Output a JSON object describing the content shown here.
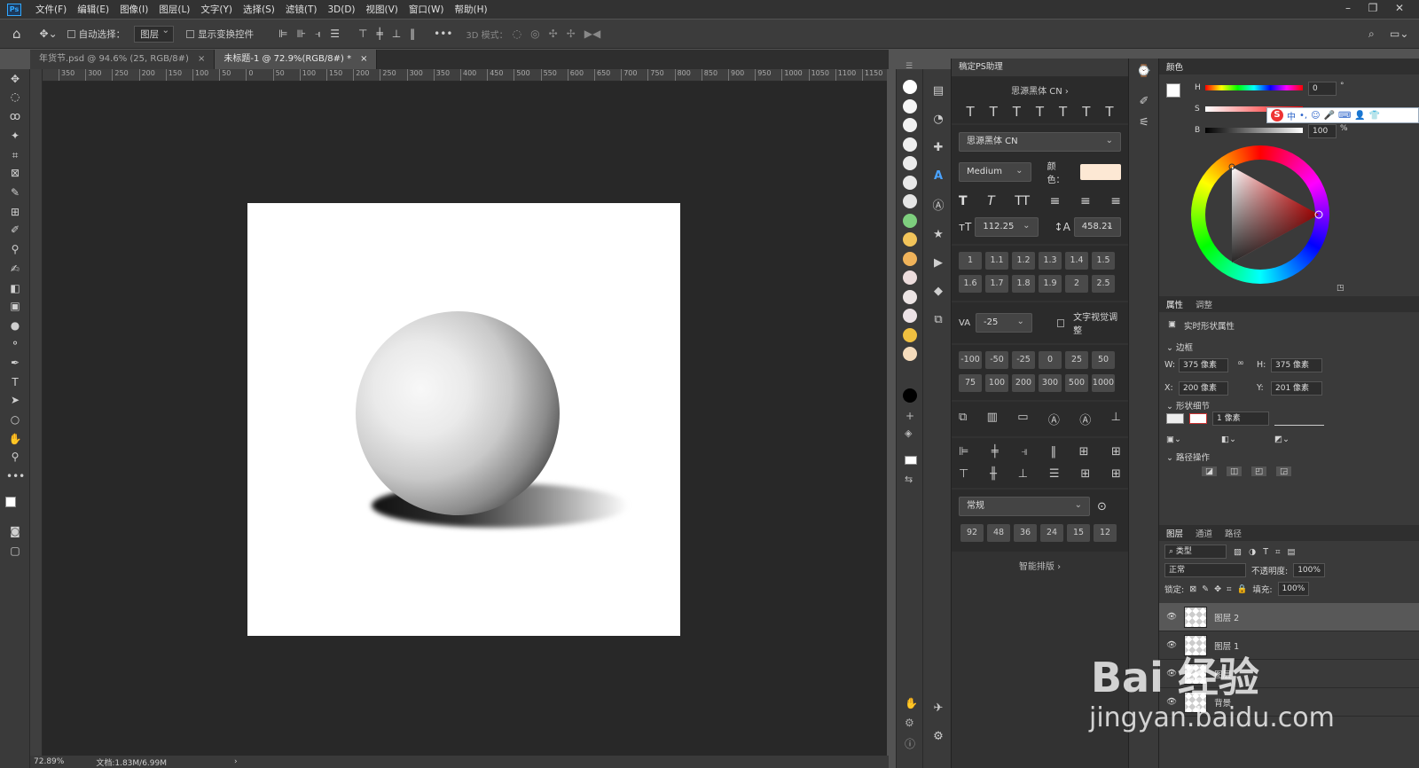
{
  "app": {
    "logo": "Ps"
  },
  "menu": [
    "文件(F)",
    "编辑(E)",
    "图像(I)",
    "图层(L)",
    "文字(Y)",
    "选择(S)",
    "滤镜(T)",
    "3D(D)",
    "视图(V)",
    "窗口(W)",
    "帮助(H)"
  ],
  "options": {
    "auto_select": "自动选择：",
    "layer_select": "图层",
    "show_transform": "显示变换控件",
    "mode_3d": "3D 模式："
  },
  "tabs": [
    {
      "label": "年货节.psd @ 94.6% (25, RGB/8#)",
      "close": "×"
    },
    {
      "label": "未标题-1 @ 72.9%(RGB/8#) *",
      "close": "×"
    }
  ],
  "ruler_ticks": [
    "350",
    "300",
    "250",
    "200",
    "150",
    "100",
    "50",
    "0",
    "50",
    "100",
    "150",
    "200",
    "250",
    "300",
    "350",
    "400",
    "450",
    "500",
    "550",
    "600",
    "650",
    "700",
    "750",
    "800",
    "850",
    "900",
    "950",
    "1000",
    "1050",
    "1100",
    "1150"
  ],
  "status": {
    "zoom": "72.89%",
    "doc": "文档:1.83M/6.99M",
    "arrow": "›"
  },
  "plugin": {
    "title": "稿定PS助理",
    "font_nav": "思源黑体 CN  ›",
    "t_row": [
      "T",
      "T",
      "T",
      "T",
      "T",
      "T",
      "T"
    ],
    "font_family": "思源黑体 CN",
    "font_weight": "Medium",
    "color_label": "颜色：",
    "color_value": "#fde8d4",
    "size": "112.25",
    "leading": "458.21",
    "scale_buttons": [
      "1",
      "1.1",
      "1.2",
      "1.3",
      "1.4",
      "1.5",
      "1.6",
      "1.7",
      "1.8",
      "1.9",
      "2",
      "2.5"
    ],
    "tracking": "-25",
    "visual_adjust": "文字视觉调整",
    "tracking_buttons": [
      "-100",
      "-50",
      "-25",
      "0",
      "25",
      "50",
      "75",
      "100",
      "200",
      "300",
      "500",
      "1000"
    ],
    "blend": "常规",
    "size_buttons": [
      "92",
      "48",
      "36",
      "24",
      "15",
      "12"
    ],
    "smart_layout": "智能排版  ›"
  },
  "swatches": [
    "#ffffff",
    "#f5f5f5",
    "#f1f1f1",
    "#eeeeee",
    "#ebebeb",
    "#e9e9e9",
    "#e5e5e5",
    "#7ecf7e",
    "#f2c45a",
    "#f0b35a",
    "#ecdcdc",
    "#ece4e4",
    "#ece2e6",
    "#f0c040",
    "#f5dcbc"
  ],
  "color_panel": {
    "title": "颜色",
    "h_label": "H",
    "h_value": "0",
    "h_unit": "°",
    "s_label": "S",
    "b_label": "B",
    "b_value": "100",
    "b_unit": "%"
  },
  "properties": {
    "tabs": [
      "属性",
      "调整"
    ],
    "heading": "实时形状属性",
    "border": "边框",
    "w_label": "W:",
    "w_value": "375 像素",
    "h_label": "H:",
    "h_value": "375 像素",
    "x_label": "X:",
    "x_value": "200 像素",
    "y_label": "Y:",
    "y_value": "201 像素",
    "shape_detail": "形状细节",
    "stroke": "1 像素",
    "path_ops": "路径操作"
  },
  "layers": {
    "tabs": [
      "图层",
      "通道",
      "路径"
    ],
    "filter": "类型",
    "blend": "正常",
    "opacity_label": "不透明度:",
    "opacity": "100%",
    "lock_label": "锁定:",
    "fill_label": "填充:",
    "fill": "100%",
    "rows": [
      "图层 2",
      "图层 1",
      "图层 ",
      "背景"
    ]
  },
  "ime": {
    "s": "S",
    "zh": "中"
  },
  "watermark": {
    "line1": "Bai 经验",
    "line2": "jingyan.baidu.com"
  }
}
